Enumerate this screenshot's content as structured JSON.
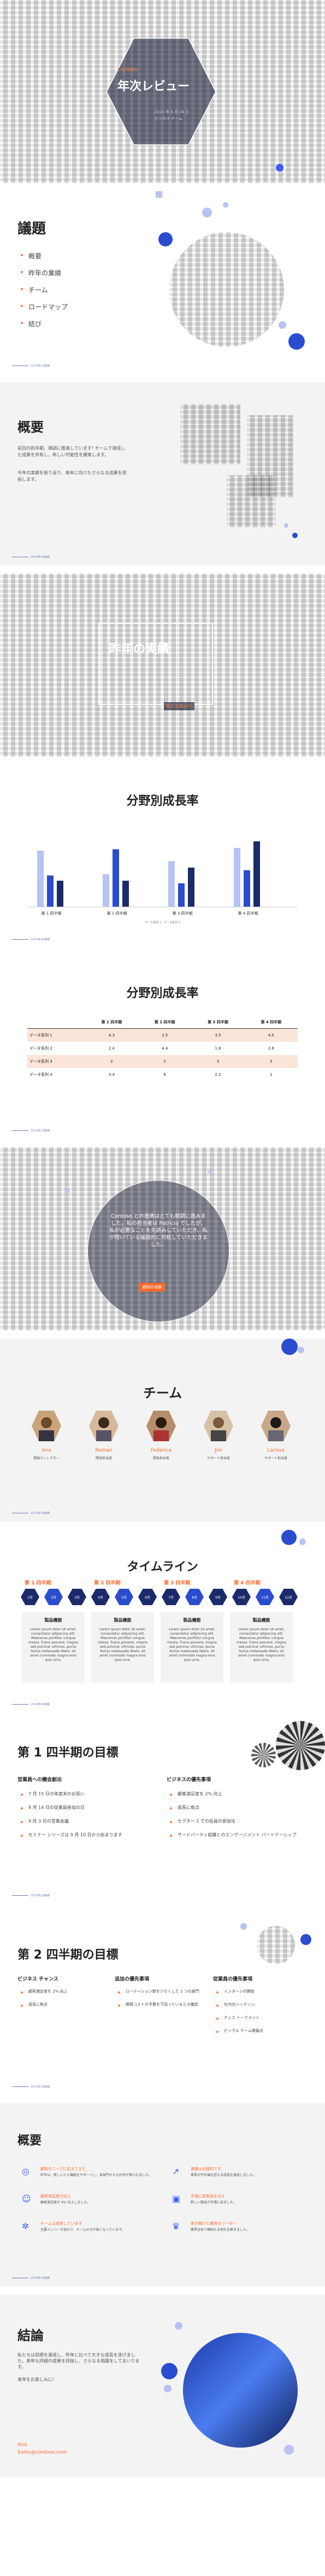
{
  "footer_text": "2024年の実績",
  "s1": {
    "company": "Contoso",
    "title": "年次レビュー",
    "date": "2024 年 6 月 24 日",
    "team": "ビジネス チーム"
  },
  "s2": {
    "title": "議題",
    "items": [
      "概要",
      "昨年の業績",
      "チーム",
      "ロードマップ",
      "結び"
    ]
  },
  "s3": {
    "title": "概要",
    "p1": "前回の四半期、順調に推進しています! チームで達成した成果を共有し、新しい可能性を模索します。",
    "p2": "今年の実績を振り返り、来年に向けたさらなる成果を目指します。"
  },
  "s4": {
    "title": "昨年の実績",
    "subtitle": "新たな高みへ"
  },
  "s5": {
    "title": "分野別成長率",
    "legend": "データ系列 1　データ系列 2",
    "chart_data": {
      "type": "bar",
      "categories": [
        "第 1 四半期",
        "第 2 四半期",
        "第 3 四半期",
        "第 4 四半期"
      ],
      "series": [
        {
          "name": "データ系列 1",
          "values": [
            4.3,
            2.5,
            3.5,
            4.5
          ]
        },
        {
          "name": "データ系列 2",
          "values": [
            2.4,
            4.4,
            1.8,
            2.8
          ]
        },
        {
          "name": "データ系列 3",
          "values": [
            2,
            2,
            3,
            5
          ]
        }
      ],
      "ylim": [
        0,
        5
      ]
    }
  },
  "s6": {
    "title": "分野別成長率",
    "headers": [
      "",
      "第 1 四半期",
      "第 2 四半期",
      "第 3 四半期",
      "第 4 四半期"
    ],
    "rows": [
      [
        "データ系列 1",
        "4.3",
        "2.5",
        "3.5",
        "4.5"
      ],
      [
        "データ系列 2",
        "2.4",
        "4.4",
        "1.8",
        "2.8"
      ],
      [
        "データ系列 3",
        "2",
        "2",
        "3",
        "5"
      ],
      [
        "データ系列 4",
        "3.4",
        "6",
        "2.2",
        "1"
      ]
    ]
  },
  "s7": {
    "quote": "Contoso との連携はとても順調に進みました。私の担当者は Patricia でしたが、私が必要なことを先読みしていただき、私が問いている議題的に対処していただきました。",
    "button": "顧客の体験"
  },
  "s8": {
    "title": "チーム",
    "members": [
      {
        "name": "Ana",
        "role": "開発ディレクター"
      },
      {
        "name": "Roman",
        "role": "開発担当者"
      },
      {
        "name": "Federica",
        "role": "開発担当者"
      },
      {
        "name": "Jim",
        "role": "サポート担当者"
      },
      {
        "name": "Larissa",
        "role": "サポート担当者"
      }
    ]
  },
  "s9": {
    "title": "タイムライン",
    "quarters": [
      "第 1 四半期",
      "第 2 四半期",
      "第 3 四半期",
      "第 4 四半期"
    ],
    "months": [
      "1月",
      "2月",
      "3月",
      "4月",
      "5月",
      "6月",
      "7月",
      "8月",
      "9月",
      "10月",
      "11月",
      "12月"
    ],
    "card_title": "製品機能",
    "card_text": "Lorem ipsum dolor sit amet, consectetur adipiscing elit. Maecenas porttitor congue massa. Fusce posuere, magna sed pulvinar ultricies, purus lectus malesuada libero, sit amet commodo magna eros quis urna."
  },
  "s10": {
    "title": "第 1 四半期の目標",
    "left_head": "営業員への機会創出",
    "left": [
      "7 月 15 日の年度末のお祝い",
      "8 月 14 日の従業員参加の日",
      "9 月 3 日の営業会議",
      "セミナー シリーズは 9 月 10 日から始まります"
    ],
    "right_head": "ビジネスの優先事項",
    "right": [
      "顧客満足度を 2% 向上",
      "成長に焦点",
      "セクター 2 での役員の参加化",
      "サードパーティ組織とのエンゲージメント パートナーシップ"
    ]
  },
  "s11": {
    "title": "第 2 四半期の目標",
    "cols": [
      {
        "head": "ビジネス チャンス",
        "items": [
          "顧客満足度を 2% 向上",
          "成長に焦点"
        ]
      },
      {
        "head": "追加の優先事項",
        "items": [
          "ローテーション数を少なくした 2 つの部門",
          "開発コストが予算を下回っているとき確認"
        ]
      },
      {
        "head": "従業員の優先事項",
        "items": [
          "インターンの開始",
          "社内のハッカソン",
          "チェス トーナメント",
          "ピックル ゲーム開催点"
        ]
      }
    ]
  },
  "s12": {
    "title": "概要",
    "items": [
      {
        "head": "顧客のニーズに応えてきた",
        "text": "昨年は、新しい人と機能をサポートし、各部門からも好評が得られました。"
      },
      {
        "head": "実績は記録的です",
        "text": "業界の平均値を超える成長を達成しました。"
      },
      {
        "head": "顧客満足度が向上",
        "text": "顧客満足度が 4% 向上しました。"
      },
      {
        "head": "市場に新製品を出す",
        "text": "新しい製品が市場に出ました。"
      },
      {
        "head": "チームは成長しています",
        "text": "主要メンバーが加わり、チームの力が強くなっています。"
      },
      {
        "head": "差が開けた業界のリーダー",
        "text": "業界全体で確固たる地位を築きました。"
      }
    ]
  },
  "s13": {
    "title": "結論",
    "text": "私たちは目標を達成し、昨年に比べて大きな成長を遂げました。来年も同様の成果を目指し、さらなる飛躍をしてまいります。",
    "text2": "来年をお楽しみに!",
    "name": "Ana",
    "email": "Sales@contoso.com"
  }
}
